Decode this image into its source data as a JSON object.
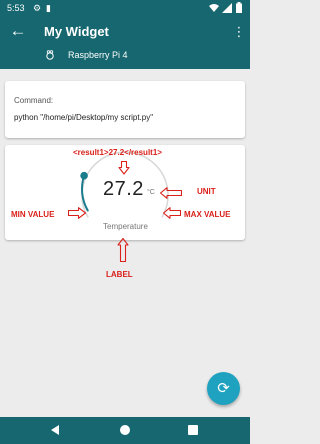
{
  "status_bar": {
    "time": "5:53"
  },
  "app_bar": {
    "title": "My Widget",
    "device": "Raspberry Pi 4"
  },
  "command_card": {
    "label": "Command:",
    "command": "python \"/home/pi/Desktop/my script.py\""
  },
  "gauge": {
    "value": "27.2",
    "unit": "°C",
    "label": "Temperature",
    "arc_fill_fraction": 0.2,
    "color": "#1a7c8c"
  },
  "annotations": {
    "result_tag": "<result1>27.2</result1>",
    "unit": "UNIT",
    "min_value": "MIN VALUE",
    "max_value": "MAX VALUE",
    "label": "LABEL"
  },
  "colors": {
    "primary": "#16676f",
    "fab": "#1ea2bf",
    "annotation": "#d9201a"
  }
}
